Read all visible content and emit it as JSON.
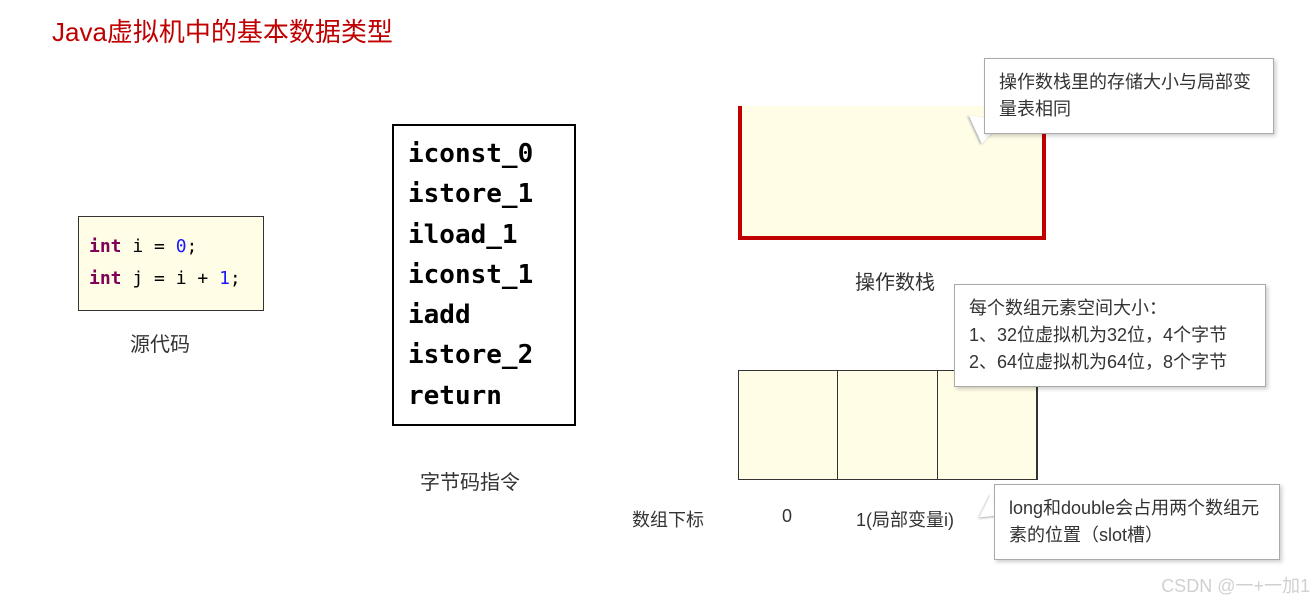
{
  "title": "Java虚拟机中的基本数据类型",
  "source": {
    "kw": "int",
    "line1_rest": " i = ",
    "line1_num": "0",
    "line1_end": ";",
    "line2_rest": " j = i + ",
    "line2_num": "1",
    "line2_end": ";",
    "label": "源代码"
  },
  "bytecode": {
    "lines": [
      "iconst_0",
      "istore_1",
      "iload_1",
      "iconst_1",
      "iadd",
      "istore_2",
      "return"
    ],
    "label": "字节码指令"
  },
  "stack": {
    "label": "操作数栈",
    "callout": "操作数栈里的存储大小与局部变量表相同"
  },
  "slots": {
    "index_label": "数组下标",
    "idx0": "0",
    "idx1": "1(局部变量i)",
    "callout_size": "每个数组元素空间大小：\n1、32位虚拟机为32位，4个字节\n2、64位虚拟机为64位，8个字节",
    "callout_longdouble": "long和double会占用两个数组元素的位置（slot槽）"
  },
  "watermark": "CSDN @一+一加1"
}
